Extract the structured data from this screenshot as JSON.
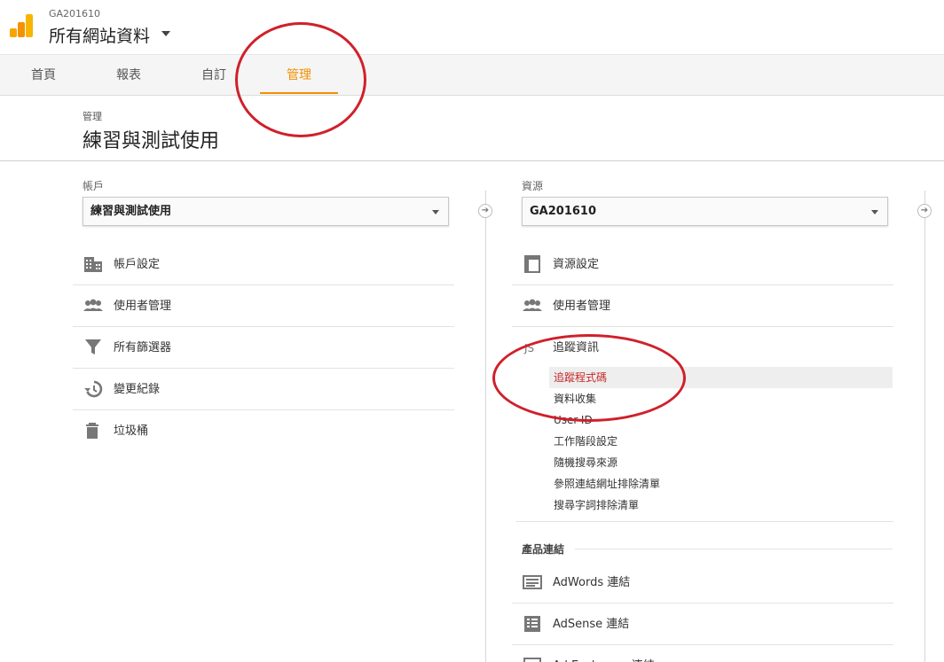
{
  "header": {
    "account_id": "GA201610",
    "view_name": "所有網站資料"
  },
  "tabs": [
    {
      "label": "首頁",
      "active": false
    },
    {
      "label": "報表",
      "active": false
    },
    {
      "label": "自訂",
      "active": false
    },
    {
      "label": "管理",
      "active": true
    }
  ],
  "page": {
    "breadcrumb": "管理",
    "title": "練習與測試使用"
  },
  "account_column": {
    "label": "帳戶",
    "selected": "練習與測試使用",
    "items": [
      {
        "label": "帳戶設定",
        "icon": "building-icon"
      },
      {
        "label": "使用者管理",
        "icon": "people-icon"
      },
      {
        "label": "所有篩選器",
        "icon": "filter-icon"
      },
      {
        "label": "變更紀錄",
        "icon": "history-icon"
      },
      {
        "label": "垃圾桶",
        "icon": "trash-icon"
      }
    ]
  },
  "property_column": {
    "label": "資源",
    "selected": "GA201610",
    "items": [
      {
        "label": "資源設定",
        "icon": "window-icon"
      },
      {
        "label": "使用者管理",
        "icon": "people-icon"
      },
      {
        "label": "追蹤資訊",
        "icon": "js-icon"
      }
    ],
    "tracking_subitems": [
      {
        "label": "追蹤程式碼",
        "active": true
      },
      {
        "label": "資料收集",
        "active": false
      },
      {
        "label": "User-ID",
        "active": false
      },
      {
        "label": "工作階段設定",
        "active": false
      },
      {
        "label": "隨機搜尋來源",
        "active": false
      },
      {
        "label": "參照連結網址排除清單",
        "active": false
      },
      {
        "label": "搜尋字詞排除清單",
        "active": false
      }
    ],
    "product_links": {
      "heading": "產品連結",
      "items": [
        {
          "label": "AdWords 連結",
          "icon": "adwords-icon"
        },
        {
          "label": "AdSense 連結",
          "icon": "adsense-icon"
        },
        {
          "label": "Ad Exchange 連結",
          "icon": "adexchange-icon"
        }
      ]
    }
  },
  "colors": {
    "accent": "#f29100",
    "annotation": "#d0202a",
    "active_sub": "#c62828"
  }
}
